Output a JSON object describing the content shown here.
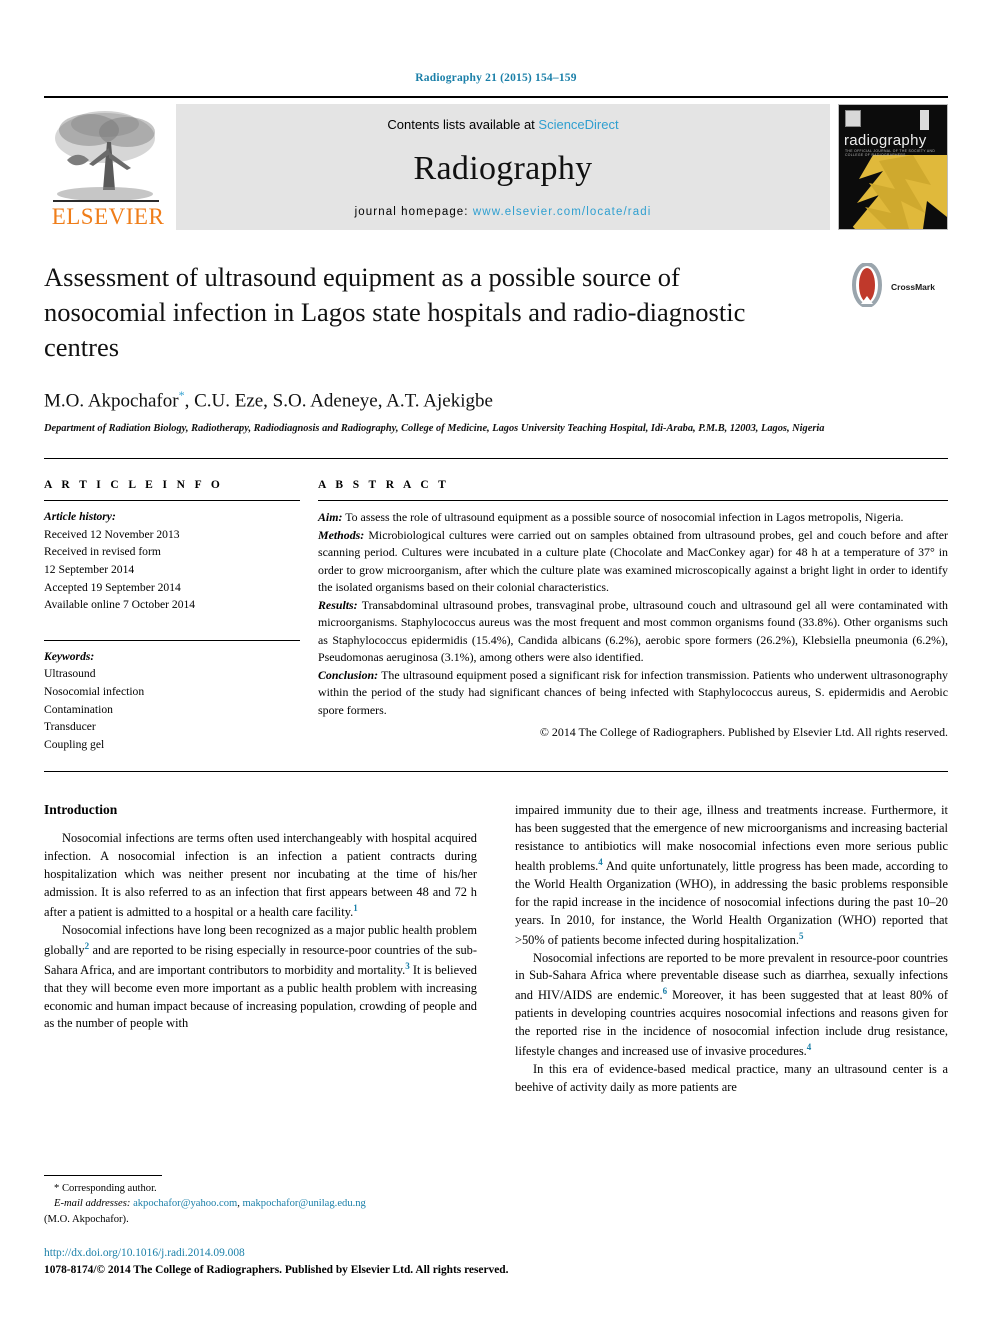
{
  "running_head": "Radiography 21 (2015) 154–159",
  "banner": {
    "publisher_name": "ELSEVIER",
    "contents_prefix": "Contents lists available at ",
    "contents_link": "ScienceDirect",
    "journal_name": "Radiography",
    "homepage_prefix": "journal homepage: ",
    "homepage_url": "www.elsevier.com/locate/radi",
    "cover_title": "radiography",
    "cover_subtitle": "THE OFFICIAL JOURNAL OF THE SOCIETY AND COLLEGE OF RADIOGRAPHERS"
  },
  "article": {
    "title": "Assessment of ultrasound equipment as a possible source of nosocomial infection in Lagos state hospitals and radio-diagnostic centres",
    "crossmark_label": "CrossMark",
    "authors": "M.O. Akpochafor",
    "authors_rest": ", C.U. Eze, S.O. Adeneye, A.T. Ajekigbe",
    "corresponding_marker": "*",
    "affiliation": "Department of Radiation Biology, Radiotherapy, Radiodiagnosis and Radiography, College of Medicine, Lagos University Teaching Hospital, Idi-Araba, P.M.B, 12003, Lagos, Nigeria"
  },
  "article_info": {
    "heading": "A R T I C L E  I N F O",
    "history_label": "Article history:",
    "history": [
      "Received 12 November 2013",
      "Received in revised form",
      "12 September 2014",
      "Accepted 19 September 2014",
      "Available online 7 October 2014"
    ],
    "keywords_label": "Keywords:",
    "keywords": [
      "Ultrasound",
      "Nosocomial infection",
      "Contamination",
      "Transducer",
      "Coupling gel"
    ]
  },
  "abstract": {
    "heading": "A B S T R A C T",
    "aim_label": "Aim:",
    "aim_text": " To assess the role of ultrasound equipment as a possible source of nosocomial infection in Lagos metropolis, Nigeria.",
    "methods_label": "Methods:",
    "methods_text": " Microbiological cultures were carried out on samples obtained from ultrasound probes, gel and couch before and after scanning period. Cultures were incubated in a culture plate (Chocolate and MacConkey agar) for 48 h at a temperature of 37° in order to grow microorganism, after which the culture plate was examined microscopically against a bright light in order to identify the isolated organisms based on their colonial characteristics.",
    "results_label": "Results:",
    "results_text": " Transabdominal ultrasound probes, transvaginal probe, ultrasound couch and ultrasound gel all were contaminated with microorganisms. Staphylococcus aureus was the most frequent and most common organisms found (33.8%). Other organisms such as Staphylococcus epidermidis (15.4%), Candida albicans (6.2%), aerobic spore formers (26.2%), Klebsiella pneumonia (6.2%), Pseudomonas aeruginosa (3.1%), among others were also identified.",
    "conclusion_label": "Conclusion:",
    "conclusion_text": " The ultrasound equipment posed a significant risk for infection transmission. Patients who underwent ultrasonography within the period of the study had significant chances of being infected with Staphylococcus aureus, S. epidermidis and Aerobic spore formers.",
    "copyright": "© 2014 The College of Radiographers. Published by Elsevier Ltd. All rights reserved."
  },
  "body": {
    "intro_heading": "Introduction",
    "left_paragraphs": [
      "Nosocomial infections are terms often used interchangeably with hospital acquired infection. A nosocomial infection is an infection a patient contracts during hospitalization which was neither present nor incubating at the time of his/her admission. It is also referred to as an infection that first appears between 48 and 72 h after a patient is admitted to a hospital or a health care facility.",
      "Nosocomial infections have long been recognized as a major public health problem globally"
    ],
    "left_p1_ref": "1",
    "left_p2_part2": " and are reported to be rising especially in resource-poor countries of the sub-Sahara Africa, and are important contributors to morbidity and mortality.",
    "left_p2_ref2": "3",
    "left_p2_part3": " It is believed that they will become even more important as a public health problem with increasing economic and human impact because of increasing population, crowding of people and as the number of people with",
    "left_p2_ref1": "2",
    "right_p1_part1": "impaired immunity due to their age, illness and treatments increase. Furthermore, it has been suggested that the emergence of new microorganisms and increasing bacterial resistance to antibiotics will make nosocomial infections even more serious public health problems.",
    "right_p1_ref1": "4",
    "right_p1_part2": " And quite unfortunately, little progress has been made, according to the World Health Organization (WHO), in addressing the basic problems responsible for the rapid increase in the incidence of nosocomial infections during the past 10–20 years. In 2010, for instance, the World Health Organization (WHO) reported that >50% of patients become infected during hospitalization.",
    "right_p1_ref2": "5",
    "right_p2_part1": "Nosocomial infections are reported to be more prevalent in resource-poor countries in Sub-Sahara Africa where preventable disease such as diarrhea, sexually infections and HIV/AIDS are endemic.",
    "right_p2_ref1": "6",
    "right_p2_part2": " Moreover, it has been suggested that at least 80% of patients in developing countries acquires nosocomial infections and reasons given for the reported rise in the incidence of nosocomial infection include drug resistance, lifestyle changes and increased use of invasive procedures.",
    "right_p2_ref2": "4",
    "right_p3": "In this era of evidence-based medical practice, many an ultrasound center is a beehive of activity daily as more patients are"
  },
  "footnote": {
    "corresponding_marker": "*",
    "corresponding_text": " Corresponding author.",
    "email_label": "E-mail addresses:",
    "email1": "akpochafor@yahoo.com",
    "email_sep": ", ",
    "email2": "makpochafor@unilag.edu.ng",
    "email_owner": "(M.O. Akpochafor)."
  },
  "page_footer": {
    "doi": "http://dx.doi.org/10.1016/j.radi.2014.09.008",
    "issn_line": "1078-8174/© 2014 The College of Radiographers. Published by Elsevier Ltd. All rights reserved."
  },
  "colors": {
    "link_blue": "#1a7fa8",
    "sciencedirect_blue": "#2f9fd0",
    "elsevier_orange": "#ef7d19",
    "cover_gold": "#e0b93b",
    "crossmark_red": "#c0392b"
  }
}
